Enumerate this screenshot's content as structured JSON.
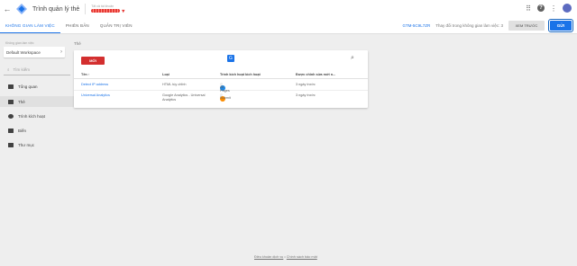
{
  "header": {
    "back_glyph": "←",
    "title": "Trình quản lý thẻ",
    "account_label": "Tất cả tài khoản",
    "account_name_redacted": true
  },
  "nav": {
    "tabs": [
      {
        "label": "KHÔNG GIAN LÀM VIỆC",
        "active": true
      },
      {
        "label": "PHIÊN BẢN",
        "active": false
      },
      {
        "label": "QUẢN TRỊ VIÊN",
        "active": false
      }
    ],
    "container_id": "GTM-5C9L7ZR",
    "workspace_changes": "Thay đổi trong không gian làm việc: 3",
    "preview_label": "XEM TRƯỚC",
    "submit_label": "GỬI"
  },
  "sidebar": {
    "workspace_label": "Không gian làm việc",
    "workspace_value": "Default Workspace",
    "search_placeholder": "Tìm kiếm",
    "items": [
      {
        "label": "Tổng quan",
        "icon": "overview-icon",
        "active": false
      },
      {
        "label": "Thẻ",
        "icon": "tag-icon",
        "active": true
      },
      {
        "label": "Trình kích hoạt",
        "icon": "trigger-icon",
        "active": false
      },
      {
        "label": "Biến",
        "icon": "variable-icon",
        "active": false
      },
      {
        "label": "Thư mục",
        "icon": "folder-icon",
        "active": false
      }
    ]
  },
  "main": {
    "page_title": "Thẻ",
    "new_button": "MỚI",
    "columns": [
      "Tên ↑",
      "Loại",
      "Trình kích hoạt kích hoạt",
      "Được chỉnh sửa mới n..."
    ],
    "rows": [
      {
        "name": "Detect IP address",
        "type": "HTML tùy chỉnh",
        "trigger": "All Pages",
        "trigger_color": "#1e88e5",
        "edited": "3 ngày trước"
      },
      {
        "name": "Universal Analytics",
        "type": "Google Analytics - Universal Analytics",
        "trigger": "Submit",
        "trigger_color": "#fb8c00",
        "edited": "3 ngày trước"
      }
    ]
  },
  "footer": {
    "terms": "Điều khoản dịch vụ",
    "separator": "•",
    "privacy": "Chính sách bảo mật"
  }
}
